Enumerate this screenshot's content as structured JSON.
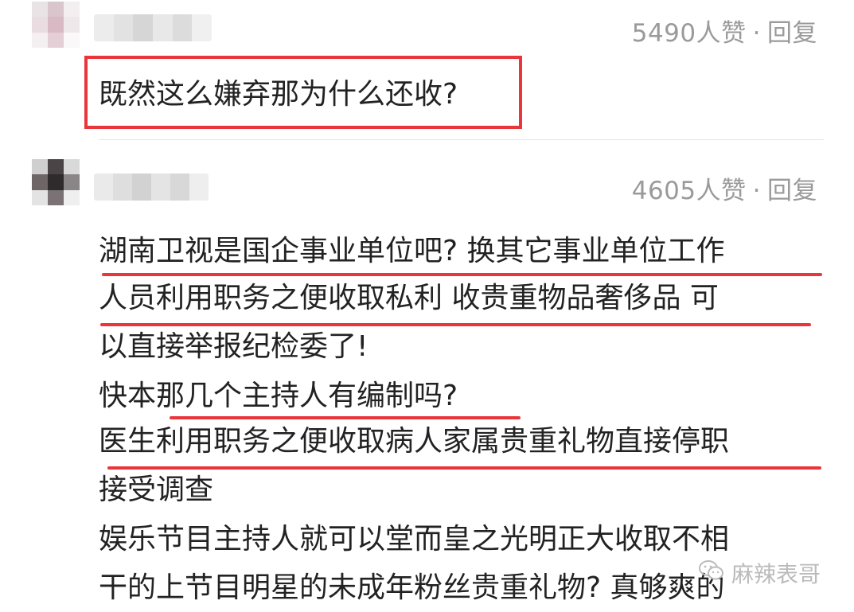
{
  "comments": [
    {
      "likes": "5490人赞",
      "separator": "·",
      "reply_label": "回复",
      "text": "既然这么嫌弃那为什么还收?"
    },
    {
      "likes": "4605人赞",
      "separator": "·",
      "reply_label": "回复",
      "lines": [
        "湖南卫视是国企事业单位吧? 换其它事业单位工作",
        "人员利用职务之便收取私利 收贵重物品奢侈品 可",
        "以直接举报纪检委了!",
        "快本那几个主持人有编制吗?",
        "医生利用职务之便收取病人家属贵重礼物直接停职",
        "接受调查",
        "娱乐节目主持人就可以堂而皇之光明正大收取不相",
        "干的上节目明星的未成年粉丝贵重礼物? 真够爽的"
      ]
    }
  ],
  "watermark": {
    "text": "麻辣表哥",
    "icon": "wechat-icon"
  },
  "colors": {
    "highlight_red": "#e8363b",
    "meta_gray": "#9a9a9a",
    "text": "#222222"
  }
}
